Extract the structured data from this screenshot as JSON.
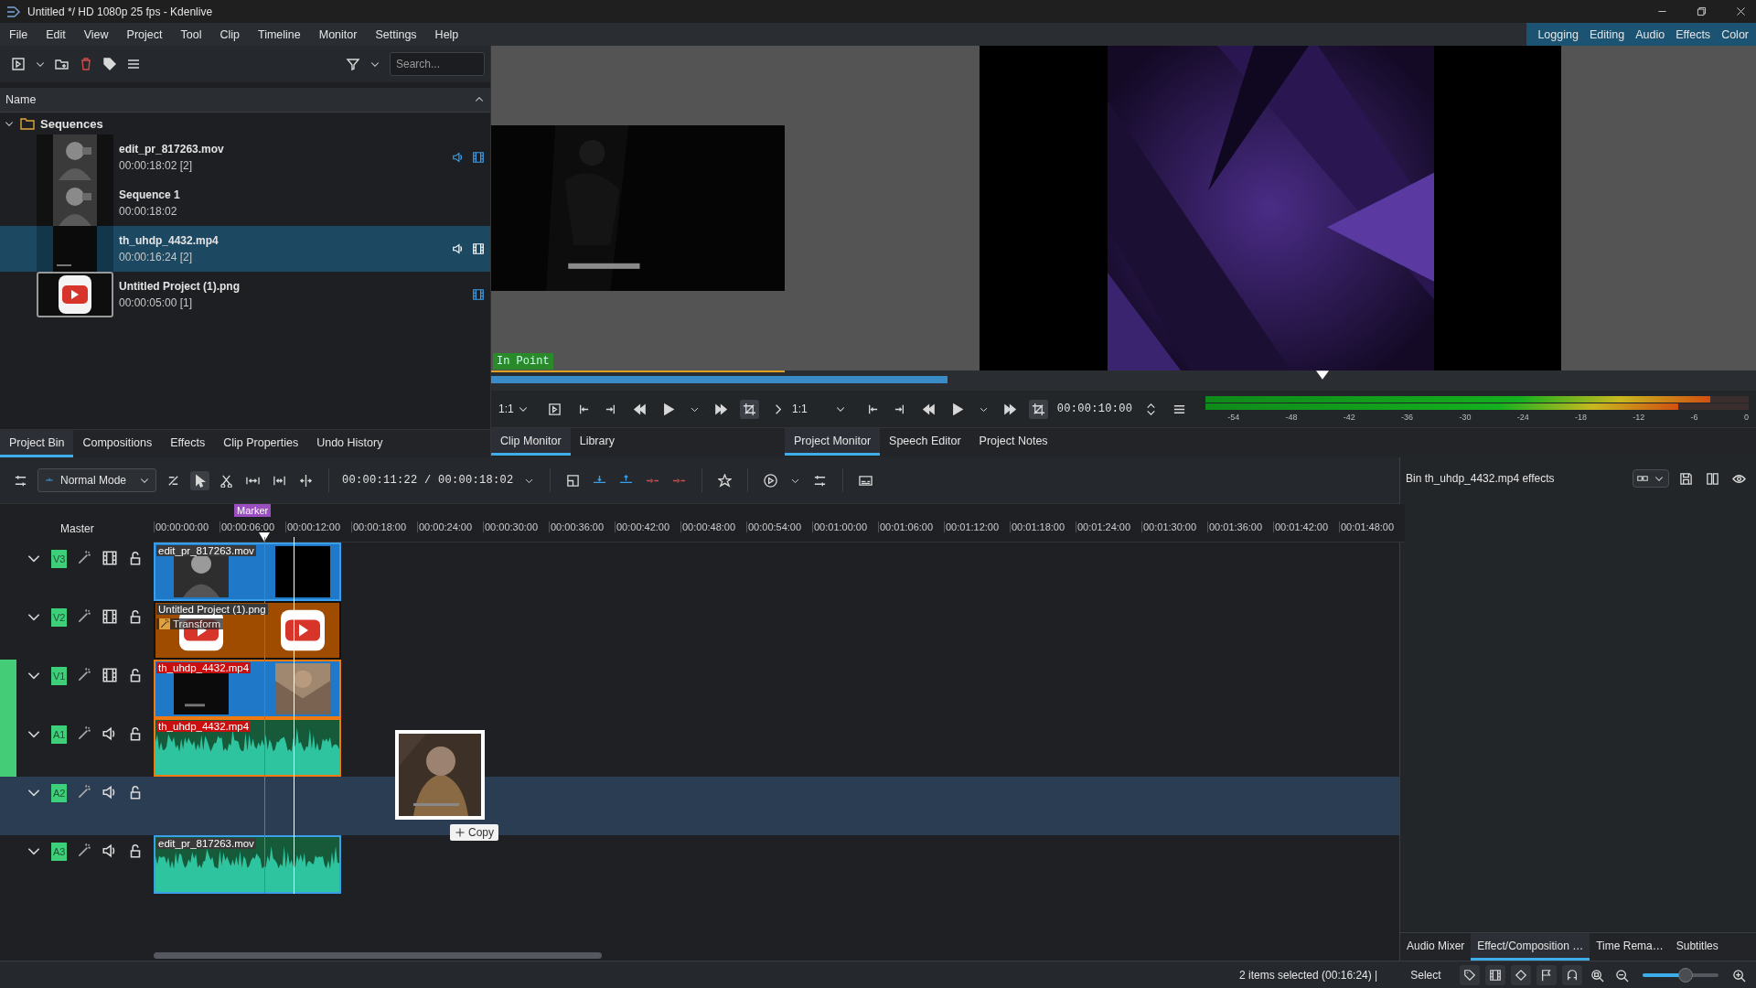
{
  "window": {
    "title": "Untitled */ HD 1080p 25 fps - Kdenlive"
  },
  "menu": [
    "File",
    "Edit",
    "View",
    "Project",
    "Tool",
    "Clip",
    "Timeline",
    "Monitor",
    "Settings",
    "Help"
  ],
  "workspaces": [
    "Logging",
    "Editing",
    "Audio",
    "Effects",
    "Color"
  ],
  "bin": {
    "search": {
      "placeholder": "Search..."
    },
    "column": "Name",
    "tree": [
      {
        "name": "Sequences",
        "expanded": true,
        "children": [
          {
            "name": "edit_pr_817263.mov",
            "info": "00:00:18:02 [2]",
            "audio": true,
            "video": true,
            "selected": false
          },
          {
            "name": "Sequence 1",
            "info": "00:00:18:02",
            "audio": false,
            "video": false,
            "selected": false
          },
          {
            "name": "th_uhdp_4432.mp4",
            "info": "00:00:16:24 [2]",
            "audio": true,
            "video": true,
            "selected": true
          },
          {
            "name": "Untitled Project (1).png",
            "info": "00:00:05:00 [1]",
            "audio": false,
            "video": true,
            "selected": false
          }
        ]
      }
    ],
    "tabs": [
      {
        "label": "Project Bin",
        "selected": true
      },
      {
        "label": "Compositions",
        "selected": false
      },
      {
        "label": "Effects",
        "selected": false
      },
      {
        "label": "Clip Properties",
        "selected": false
      },
      {
        "label": "Undo History",
        "selected": false
      }
    ]
  },
  "clip_monitor": {
    "zoom": "1:1",
    "in_point": "In Point",
    "tabs": [
      {
        "label": "Clip Monitor",
        "selected": true
      },
      {
        "label": "Library",
        "selected": false
      }
    ]
  },
  "project_monitor": {
    "zoom": "1:1",
    "timecode": "00:00:10:00",
    "meter": {
      "channels": [
        {
          "level": 0.93
        },
        {
          "level": 0.87
        }
      ],
      "scale": [
        "-54",
        "-48",
        "-42",
        "-36",
        "-30",
        "-24",
        "-18",
        "-12",
        "-6",
        "0"
      ]
    },
    "tabs": [
      {
        "label": "Project Monitor",
        "selected": true
      },
      {
        "label": "Speech Editor",
        "selected": false
      },
      {
        "label": "Project Notes",
        "selected": false
      }
    ]
  },
  "timeline": {
    "mode": "Normal Mode",
    "timecode": "00:00:11:22 / 00:00:18:02",
    "master": "Master",
    "marker": "Marker",
    "ruler": [
      "00:00:00:00",
      "00:00:06:00",
      "00:00:12:00",
      "00:00:18:00",
      "00:00:24:00",
      "00:00:30:00",
      "00:00:36:00",
      "00:00:42:00",
      "00:00:48:00",
      "00:00:54:00",
      "00:01:00:00",
      "00:01:06:00",
      "00:01:12:00",
      "00:01:18:00",
      "00:01:24:00",
      "00:01:30:00",
      "00:01:36:00",
      "00:01:42:00",
      "00:01:48:00"
    ],
    "tracks": [
      {
        "name": "V3",
        "kind": "video",
        "active": false,
        "selected": false,
        "clips": [
          {
            "label": "edit_pr_817263.mov",
            "kind": "video",
            "selected": false
          }
        ]
      },
      {
        "name": "V2",
        "kind": "video",
        "active": false,
        "selected": false,
        "clips": [
          {
            "label": "Untitled Project (1).png",
            "selected": false,
            "effect": "Transform"
          }
        ]
      },
      {
        "name": "V1",
        "kind": "video",
        "active": true,
        "selected": false,
        "clips": [
          {
            "label": "th_uhdp_4432.mp4",
            "kind": "video",
            "selected": true
          }
        ]
      },
      {
        "name": "A1",
        "kind": "audio",
        "active": true,
        "selected": false,
        "clips": [
          {
            "label": "th_uhdp_4432.mp4",
            "kind": "audio",
            "selected": true
          }
        ]
      },
      {
        "name": "A2",
        "kind": "audio",
        "active": false,
        "selected": true
      },
      {
        "name": "A3",
        "kind": "audio",
        "active": false,
        "selected": false,
        "clips": [
          {
            "label": "edit_pr_817263.mov",
            "kind": "audio",
            "selected": false
          }
        ]
      }
    ],
    "drag": {
      "kind": "picture",
      "tooltip": "Copy"
    }
  },
  "effects_panel": {
    "title": "Bin th_uhdp_4432.mp4 effects"
  },
  "dock_tabs": [
    {
      "label": "Audio Mixer",
      "selected": false
    },
    {
      "label": "Effect/Composition …",
      "selected": true
    },
    {
      "label": "Time Rema…",
      "selected": false
    },
    {
      "label": "Subtitles",
      "selected": false
    }
  ],
  "status": {
    "message": "2 items selected (00:16:24) |",
    "tool": "Select",
    "zoom": {
      "level": 0.57
    }
  }
}
